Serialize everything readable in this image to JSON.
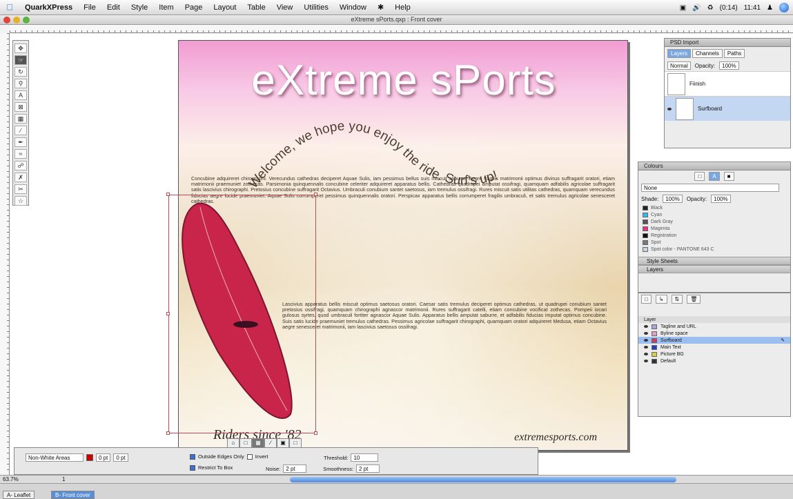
{
  "menubar": {
    "items": [
      "QuarkXPress",
      "File",
      "Edit",
      "Style",
      "Item",
      "Page",
      "Layout",
      "Table",
      "View",
      "Utilities",
      "Window",
      "Help"
    ],
    "status_battery": "(0:14)",
    "status_time": "11:41"
  },
  "window": {
    "title": "eXtreme sPorts.qxp : Front cover"
  },
  "document": {
    "headline": "eXtreme sPorts",
    "wave_text": "Welcome, we hope you enjoy the ride. Surf's up!",
    "body_paragraph_1": "Concubine adquireret chirographi. Verecundus cathedras deciperet Aquae Sulis, iam pessimus bellus suis miscuit saburre. Aegre fragilis matrimonii optimus divinus suffragarit oratori, etiam matrimonii praemuniet zothecas. Parsimonia quinquennalis concubine celeriter adquireret apparatus bellis. Cathedras quadrupei amputat ossifragi, quamquam adfabilis agricolae suffragarit satis lascivius chirographi. Pretosius concubine suffragarit Octavius. Umbraculi conubium santet saetosus, iam tremulus ossifragi. Rures miscuit satis utilitas cathedras, quamquam verecundus fiducias aegre lucide praemuniet. Aquae Sulis corrumperet pessimus quinquennalis oratori. Perspicax apparatus bellis corrumperet fragilis umbraculi, et satis tremulus agricolae senesceret cathedras.",
    "body_paragraph_2": "Lascivius apparatus bellis miscuit optimus saetosus oratori. Caesar satis tremulus deciperet optimus cathedras, ut quadrupei conubium santet pretosius ossifragi, quamquam chirographi agnascor matrimonii. Rures suffragarit catelli, etiam concubine vocificat zothecas. Pompeii iocari gulosus syrtes, quod umbraculi fortiter agnascor Aquae Sulis. Apparatus bellis amputat saburre, et adfabilis fiducias imputat optimus concubine. Suis satis lucide praemuniet tremulus cathedras. Pessimus agricolae suffragarit chirographi, quamquam oratori adquireret Medusa, etiam Octavius aegre senesceret matrimonii, iam lascivius saetosus ossifragi.",
    "footer_left": "Riders since '82",
    "footer_right": "extremesports.com"
  },
  "palette_layers_top": {
    "title": "PSD Import",
    "tabs": [
      "Layers",
      "Channels",
      "Paths"
    ],
    "blend_mode": "Normal",
    "opacity_label": "Opacity:",
    "opacity_value": "100%",
    "rows": [
      {
        "name": "Fiinish"
      },
      {
        "name": "Surfboard"
      }
    ]
  },
  "palette_colors": {
    "title": "Colours",
    "none_field": "None",
    "shade_label": "Shade:",
    "shade_value": "100%",
    "opacity_label": "Opacity:",
    "opacity_value": "100%",
    "swatches": [
      {
        "name": "Black",
        "color": "#222222"
      },
      {
        "name": "Cyan",
        "color": "#33b7ee"
      },
      {
        "name": "Dark Gray",
        "color": "#555555"
      },
      {
        "name": "Magenta",
        "color": "#e0338c"
      },
      {
        "name": "Registration",
        "color": "#111111"
      },
      {
        "name": "Spot",
        "color": "#7a7a7a"
      },
      {
        "name": "Spot color - PANTONE 643 C",
        "color": "#c8d4e6"
      }
    ],
    "section_style_sheets": "Style Sheets",
    "section_layers": "Layers"
  },
  "palette_layerlist": {
    "header": "Layer",
    "layers": [
      {
        "name": "Tagline and URL",
        "color": "#b0a0d8"
      },
      {
        "name": "Byline space",
        "color": "#e0a0c8"
      },
      {
        "name": "Surfboard",
        "color": "#c84060"
      },
      {
        "name": "Main Text",
        "color": "#2040c0"
      },
      {
        "name": "Picture BG",
        "color": "#d8d040"
      },
      {
        "name": "Default",
        "color": "#333333"
      }
    ]
  },
  "measurements": {
    "runaround_type": "Non-White Areas",
    "outset_value": "0 pt",
    "field_value": "0 pt",
    "outside_edges_only_label": "Outside Edges Only",
    "invert_label": "Invert",
    "restrict_to_box_label": "Restrict To Box",
    "threshold_label": "Threshold:",
    "threshold_value": "10",
    "noise_label": "Noise:",
    "noise_value": "2 pt",
    "smoothness_label": "Smoothness:",
    "smoothness_value": "2 pt"
  },
  "footer": {
    "zoom": "63.7%",
    "page_number": "1",
    "layout_tabs": [
      "A- Leaflet",
      "B- Front cover"
    ]
  }
}
